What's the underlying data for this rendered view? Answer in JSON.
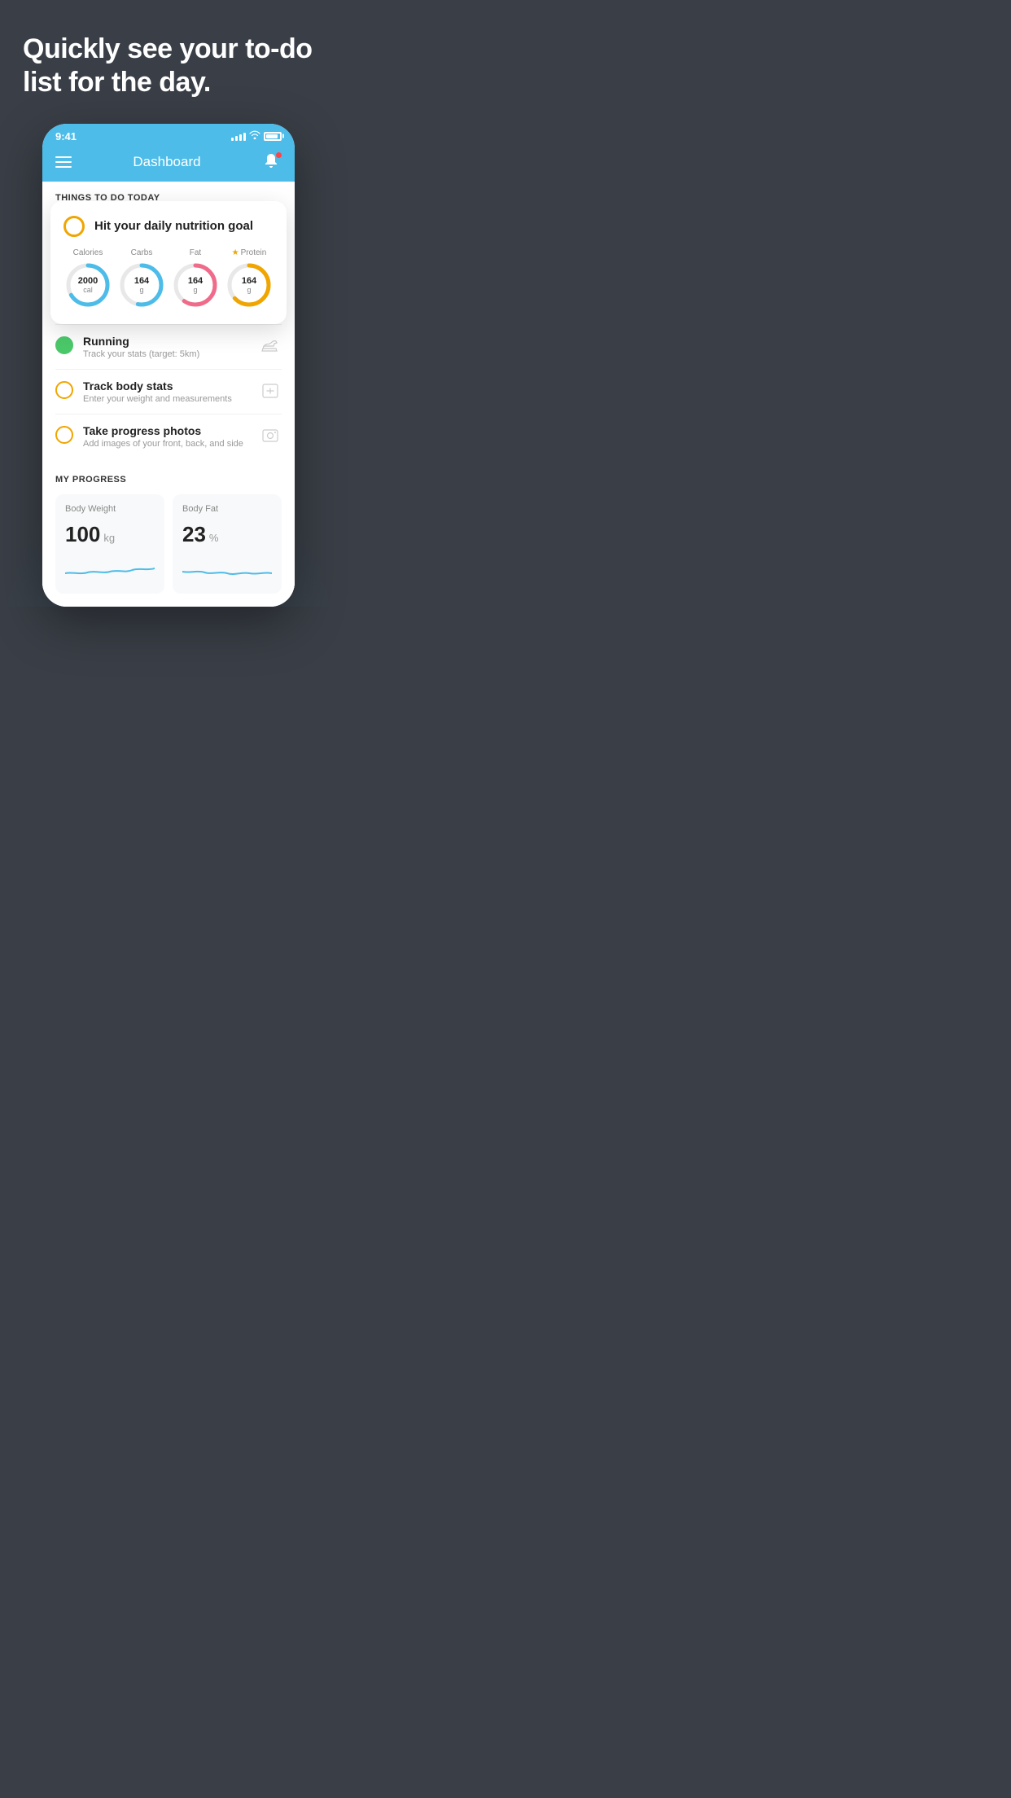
{
  "page": {
    "background_color": "#3a3f47"
  },
  "hero": {
    "title": "Quickly see your to-do list for the day."
  },
  "status_bar": {
    "time": "9:41"
  },
  "nav": {
    "title": "Dashboard"
  },
  "things_to_do": {
    "section_label": "THINGS TO DO TODAY"
  },
  "floating_card": {
    "check_label": "circle-check",
    "title": "Hit your daily nutrition goal",
    "nutrition": [
      {
        "label": "Calories",
        "value": "2000",
        "unit": "cal",
        "color": "#4dbce9",
        "star": false
      },
      {
        "label": "Carbs",
        "value": "164",
        "unit": "g",
        "color": "#4dbce9",
        "star": false
      },
      {
        "label": "Fat",
        "value": "164",
        "unit": "g",
        "color": "#f06b8a",
        "star": false
      },
      {
        "label": "Protein",
        "value": "164",
        "unit": "g",
        "color": "#f0a500",
        "star": true
      }
    ]
  },
  "todo_items": [
    {
      "id": "running",
      "name": "Running",
      "desc": "Track your stats (target: 5km)",
      "circle_type": "green",
      "icon": "shoe"
    },
    {
      "id": "track-body-stats",
      "name": "Track body stats",
      "desc": "Enter your weight and measurements",
      "circle_type": "yellow",
      "icon": "scale"
    },
    {
      "id": "progress-photos",
      "name": "Take progress photos",
      "desc": "Add images of your front, back, and side",
      "circle_type": "yellow",
      "icon": "photo"
    }
  ],
  "progress": {
    "section_label": "MY PROGRESS",
    "cards": [
      {
        "id": "body-weight",
        "title": "Body Weight",
        "value": "100",
        "unit": "kg"
      },
      {
        "id": "body-fat",
        "title": "Body Fat",
        "value": "23",
        "unit": "%"
      }
    ]
  }
}
